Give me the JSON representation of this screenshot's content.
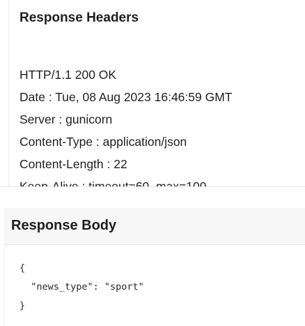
{
  "response_headers": {
    "title": "Response Headers",
    "lines": [
      "HTTP/1.1 200 OK",
      "Date : Tue, 08 Aug 2023 16:46:59 GMT",
      "Server : gunicorn",
      "Content-Type : application/json",
      "Content-Length : 22",
      "Keep-Alive : timeout=60, max=100"
    ]
  },
  "response_body": {
    "title": "Response Body",
    "code_lines": [
      "{",
      "  \"news_type\": \"sport\"",
      "}"
    ]
  }
}
